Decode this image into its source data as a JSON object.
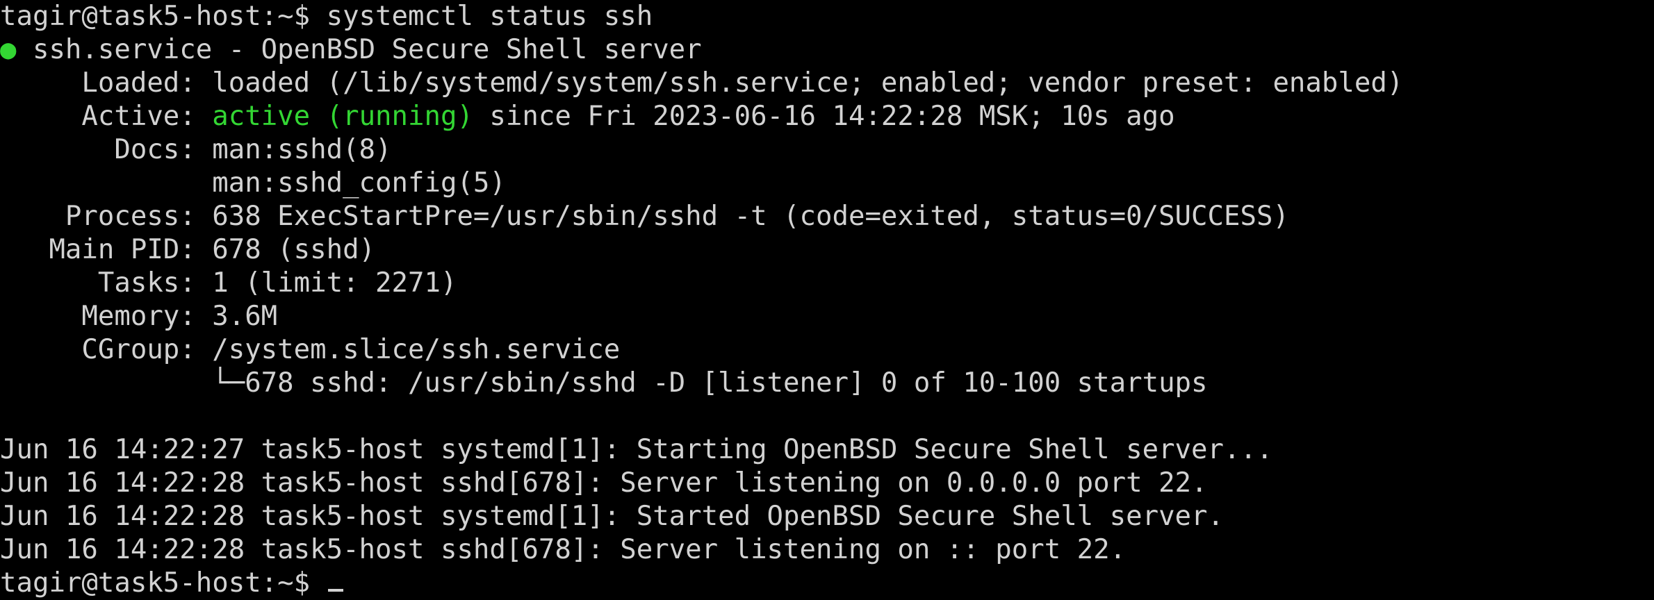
{
  "terminal": {
    "prompt_1": "tagir@task5-host:~$ ",
    "command": "systemctl status ssh",
    "status_dot": "●",
    "unit_line": " ssh.service - OpenBSD Secure Shell server",
    "loaded": "     Loaded: loaded (/lib/systemd/system/ssh.service; enabled; vendor preset: enabled)",
    "active_label": "     Active: ",
    "active_state": "active (running)",
    "active_rest": " since Fri 2023-06-16 14:22:28 MSK; 10s ago",
    "docs_1": "       Docs: man:sshd(8)",
    "docs_2": "             man:sshd_config(5)",
    "process": "    Process: 638 ExecStartPre=/usr/sbin/sshd -t (code=exited, status=0/SUCCESS)",
    "main_pid": "   Main PID: 678 (sshd)",
    "tasks": "      Tasks: 1 (limit: 2271)",
    "memory": "     Memory: 3.6M",
    "cgroup": "     CGroup: /system.slice/ssh.service",
    "cgroup_child": "             └─678 sshd: /usr/sbin/sshd -D [listener] 0 of 10-100 startups",
    "log": [
      "Jun 16 14:22:27 task5-host systemd[1]: Starting OpenBSD Secure Shell server...",
      "Jun 16 14:22:28 task5-host sshd[678]: Server listening on 0.0.0.0 port 22.",
      "Jun 16 14:22:28 task5-host systemd[1]: Started OpenBSD Secure Shell server.",
      "Jun 16 14:22:28 task5-host sshd[678]: Server listening on :: port 22."
    ],
    "prompt_2": "tagir@task5-host:~$ "
  },
  "colors": {
    "background": "#000000",
    "foreground": "#d2d2d2",
    "active_green": "#33d633"
  }
}
